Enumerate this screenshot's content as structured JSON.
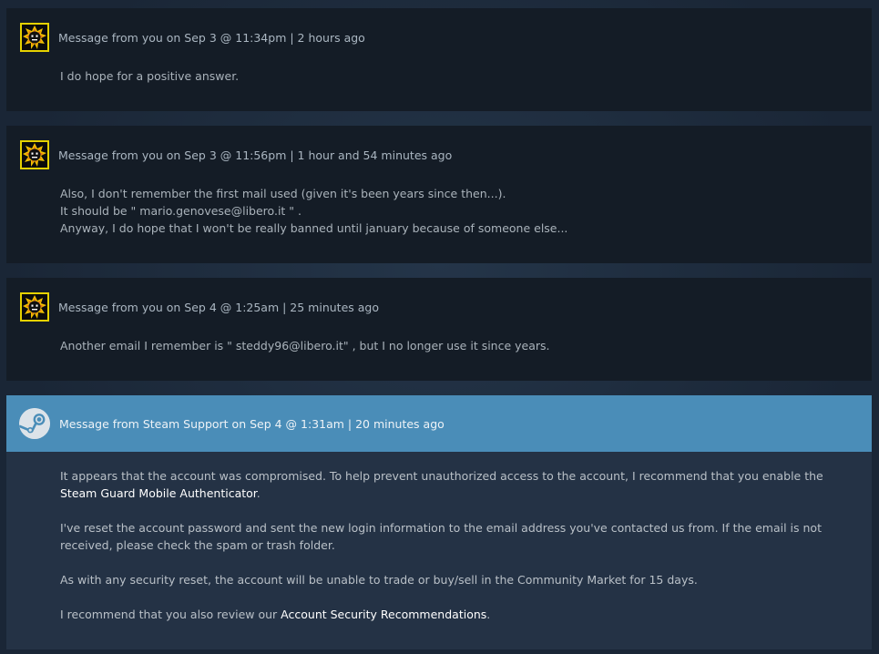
{
  "messages": [
    {
      "header": "Message from you on Sep 3 @ 11:34pm | 2 hours ago",
      "lines": [
        "I do hope for a positive answer."
      ]
    },
    {
      "header": "Message from you on Sep 3 @ 11:56pm | 1 hour and 54 minutes ago",
      "lines": [
        "Also, I don't remember the first mail used (given it's been years since then...).",
        "It should be \" mario.genovese@libero.it \" .",
        "Anyway, I do hope that I won't be really banned until january because of someone else..."
      ]
    },
    {
      "header": "Message from you on Sep 4 @ 1:25am | 25 minutes ago",
      "lines": [
        "Another email I remember is \" steddy96@libero.it\" , but I no longer use it since years."
      ]
    }
  ],
  "support": {
    "header": "Message from Steam Support on Sep 4 @ 1:31am | 20 minutes ago",
    "p1_text": "It appears that the account was compromised. To help prevent unauthorized access to the account, I recommend that you enable the ",
    "p1_link": "Steam Guard Mobile Authenticator",
    "p1_end": ".",
    "p2": "I've reset the account password and sent the new login information to the email address you've contacted us from. If the email is not received, please check the spam or trash folder.",
    "p3": "As with any security reset, the account will be unable to trade or buy/sell in the Community Market for 15 days.",
    "p4_text": "I recommend that you also review our ",
    "p4_link": "Account Security Recommendations",
    "p4_end": "."
  },
  "colors": {
    "avatar_border": "#e6d200",
    "support_header": "#4a8db8",
    "user_message_bg": "#141c26",
    "support_body_bg": "#243245"
  },
  "icons": {
    "user_avatar": "serious-sam-bomb-avatar-icon",
    "support_avatar": "steam-logo-icon"
  }
}
